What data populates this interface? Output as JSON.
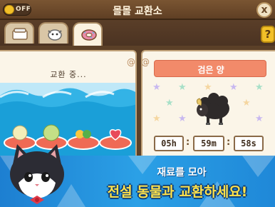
{
  "header": {
    "toggle_label": "OFF",
    "title": "몰몰 교환소",
    "close_label": "x"
  },
  "tabs": [
    {
      "id": "chest",
      "icon": "chest-icon",
      "active": false
    },
    {
      "id": "cow",
      "icon": "cow-icon",
      "active": false
    },
    {
      "id": "donut",
      "icon": "donut-icon",
      "active": true
    }
  ],
  "help_label": "?",
  "exchange": {
    "status": "교환 중..."
  },
  "reward": {
    "name": "검은 양",
    "icon": "black-sheep-icon"
  },
  "timer": {
    "hours": "05h",
    "minutes": "59m",
    "seconds": "58s"
  },
  "promo": {
    "line1": "재료를 모아",
    "line2": "전설 동물과 교환하세요!"
  },
  "colors": {
    "accent_orange": "#f28a6a",
    "promo_blue": "#1f88d8",
    "promo_yellow": "#ffe14a",
    "wood_brown": "#5f3f24"
  }
}
